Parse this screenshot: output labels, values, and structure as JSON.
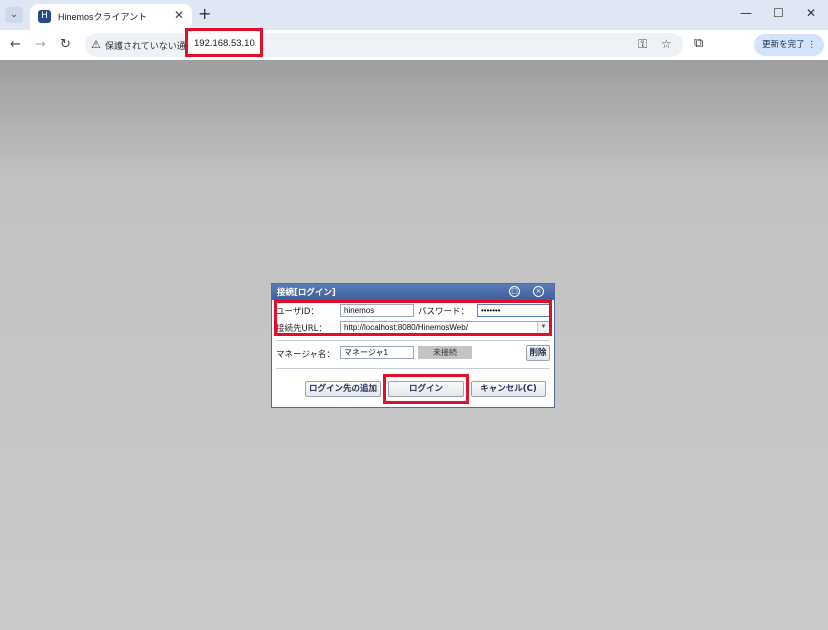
{
  "browser": {
    "tab": {
      "title": "Hinemosクライアント",
      "favicon": "hinemos-logo",
      "close": "✕"
    },
    "new_tab": "+",
    "window_controls": {
      "minimize": "—",
      "maximize": "☐",
      "close": "✕"
    },
    "nav": {
      "back": "←",
      "forward": "→",
      "reload": "↻"
    },
    "address": {
      "security": "保護されていない通信",
      "url": "192.168.53.10",
      "warning_icon": "⚠"
    },
    "update_button": "更新を完了 ⋮",
    "extensions_icon": "puzzle-icon"
  },
  "dialog": {
    "title": "接続[ログイン]",
    "user_id_label": "ユーザID：",
    "user_id_value": "hinemos",
    "password_label": "パスワード：",
    "password_value": "•••••••",
    "url_label": "接続先URL：",
    "url_value": "http://localhost:8080/HinemosWeb/",
    "manager_label": "マネージャ名：",
    "manager_value": "マネージャ1",
    "status": "未接続",
    "delete_button": "削除",
    "add_button": "ログイン先の追加",
    "login_button": "ログイン",
    "cancel_button": "キャンセル(C)"
  },
  "colors": {
    "highlight": "#e0102a",
    "title_bar": "#4a6ca8"
  }
}
